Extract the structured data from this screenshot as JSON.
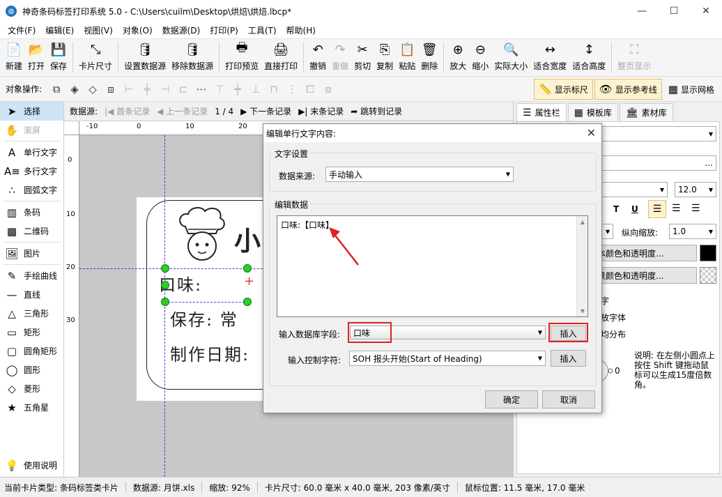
{
  "window": {
    "app_icon_glyph": "◍",
    "title": "神奇条码标签打印系统 5.0 - C:\\Users\\cuilm\\Desktop\\烘焙\\烘焙.lbcp*",
    "minimize": "—",
    "maximize": "☐",
    "close": "✕"
  },
  "menu": [
    "文件(F)",
    "编辑(E)",
    "视图(V)",
    "对象(O)",
    "数据源(D)",
    "打印(P)",
    "工具(T)",
    "帮助(H)"
  ],
  "toolbar": [
    {
      "label": "新建",
      "icon": "📄",
      "name": "new-icon"
    },
    {
      "label": "打开",
      "icon": "📂",
      "name": "open-icon"
    },
    {
      "label": "保存",
      "icon": "💾",
      "name": "save-icon"
    },
    {
      "label": "卡片尺寸",
      "icon": "⤡",
      "name": "card-size-icon"
    },
    {
      "label": "设置数据源",
      "icon": "🛢",
      "name": "set-datasource-icon"
    },
    {
      "label": "移除数据源",
      "icon": "🛢",
      "name": "remove-datasource-icon"
    },
    {
      "label": "打印预览",
      "icon": "🖶",
      "name": "print-preview-icon"
    },
    {
      "label": "直接打印",
      "icon": "🖨",
      "name": "print-icon"
    },
    {
      "label": "撤销",
      "icon": "↶",
      "name": "undo-icon"
    },
    {
      "label": "重做",
      "icon": "↷",
      "name": "redo-icon"
    },
    {
      "label": "剪切",
      "icon": "✂",
      "name": "cut-icon"
    },
    {
      "label": "复制",
      "icon": "⎘",
      "name": "copy-icon"
    },
    {
      "label": "粘贴",
      "icon": "📋",
      "name": "paste-icon"
    },
    {
      "label": "删除",
      "icon": "🗑",
      "name": "delete-icon"
    },
    {
      "label": "放大",
      "icon": "⊕",
      "name": "zoom-in-icon"
    },
    {
      "label": "缩小",
      "icon": "⊖",
      "name": "zoom-out-icon"
    },
    {
      "label": "实际大小",
      "icon": "🔍",
      "name": "actual-size-icon"
    },
    {
      "label": "适合宽度",
      "icon": "↔",
      "name": "fit-width-icon"
    },
    {
      "label": "适合高度",
      "icon": "↕",
      "name": "fit-height-icon"
    },
    {
      "label": "整页显示",
      "icon": "⛶",
      "name": "fit-page-icon"
    }
  ],
  "objbar": {
    "label": "对象操作:",
    "show_ruler": "显示标尺",
    "show_guides": "显示参考线",
    "show_grid": "显示网格",
    "ruler_icon": "📏",
    "guides_icon": "👁",
    "grid_icon": "▦"
  },
  "left_tools": [
    {
      "label": "选择",
      "icon": "➤",
      "name": "select-tool",
      "icon_name": "cursor-icon"
    },
    {
      "label": "滚屏",
      "icon": "✋",
      "name": "scroll-tool",
      "icon_name": "hand-icon"
    },
    {
      "label": "单行文字",
      "icon": "A",
      "name": "single-line-text-tool",
      "icon_name": "text-icon"
    },
    {
      "label": "多行文字",
      "icon": "A≡",
      "name": "multi-line-text-tool",
      "icon_name": "multiline-text-icon"
    },
    {
      "label": "圆弧文字",
      "icon": "∴",
      "name": "arc-text-tool",
      "icon_name": "arc-text-icon"
    },
    {
      "label": "条码",
      "icon": "▥",
      "name": "barcode-tool",
      "icon_name": "barcode-icon"
    },
    {
      "label": "二维码",
      "icon": "▩",
      "name": "qrcode-tool",
      "icon_name": "qrcode-icon"
    },
    {
      "label": "图片",
      "icon": "🖼",
      "name": "image-tool",
      "icon_name": "image-icon"
    },
    {
      "label": "手绘曲线",
      "icon": "✎",
      "name": "freehand-tool",
      "icon_name": "pen-icon"
    },
    {
      "label": "直线",
      "icon": "—",
      "name": "line-tool",
      "icon_name": "line-icon"
    },
    {
      "label": "三角形",
      "icon": "△",
      "name": "triangle-tool",
      "icon_name": "triangle-icon"
    },
    {
      "label": "矩形",
      "icon": "▭",
      "name": "rectangle-tool",
      "icon_name": "rectangle-icon"
    },
    {
      "label": "圆角矩形",
      "icon": "▢",
      "name": "rounded-rect-tool",
      "icon_name": "rounded-rect-icon"
    },
    {
      "label": "圆形",
      "icon": "◯",
      "name": "circle-tool",
      "icon_name": "circle-icon"
    },
    {
      "label": "菱形",
      "icon": "◇",
      "name": "diamond-tool",
      "icon_name": "diamond-icon"
    },
    {
      "label": "五角星",
      "icon": "★",
      "name": "star-tool",
      "icon_name": "star-icon"
    }
  ],
  "help": {
    "label": "使用说明",
    "icon": "💡"
  },
  "navbar": {
    "datasource_label": "数据源:",
    "first": "|◀ 首条记录",
    "prev": "◀ 上一条记录",
    "counter": "1 / 4",
    "next": "▶ 下一条记录",
    "last": "▶| 末条记录",
    "jump": "➦ 跳转到记录"
  },
  "ruler": {
    "h_ticks": [
      "-10",
      "0",
      "10",
      "20"
    ],
    "v_ticks": [
      "0",
      "10",
      "20",
      "30"
    ]
  },
  "label": {
    "title_char": "小",
    "line1_prefix": "口味:",
    "line2": "保存: 常",
    "line3": "制作日期:",
    "cursor_mark": "+"
  },
  "right_panel": {
    "tabs": [
      {
        "label": "属性栏",
        "icon": "☰",
        "name": "tab-properties"
      },
      {
        "label": "模板库",
        "icon": "▦",
        "name": "tab-templates"
      },
      {
        "label": "素材库",
        "icon": "🏛",
        "name": "tab-materials"
      }
    ],
    "font_size": "12.0",
    "style_buttons": [
      "T",
      "U"
    ],
    "v_scale_label": "纵向缩放:",
    "v_scale_value": "1.0",
    "text_color_btn": "本颜色和透明度...",
    "bg_color_btn": "景颜色和透明度...",
    "line_zi": "字",
    "line_font": "放字体",
    "line_dist": "均分布",
    "rotate_value": "0",
    "hint": "说明: 在左侧小圆点上按住 Shift 键拖动鼠标可以生成15度倍数角。",
    "ellipsis": "..."
  },
  "status": {
    "card_type": "当前卡片类型: 条码标签类卡片",
    "datasource": "数据源: 月饼.xls",
    "zoom": "缩放: 92%",
    "card_size": "卡片尺寸: 60.0 毫米 x 40.0 毫米, 203 像素/英寸",
    "mouse": "鼠标位置: 11.5 毫米, 17.0 毫米"
  },
  "dialog": {
    "title": "编辑单行文字内容:",
    "close": "✕",
    "group_text": "文字设置",
    "source_label": "数据来源:",
    "source_value": "手动输入",
    "group_edit": "编辑数据",
    "content": "口味:【口味】",
    "db_field_label": "输入数据库字段:",
    "db_field_value": "口味",
    "insert1": "插入",
    "ctrl_label": "输入控制字符:",
    "ctrl_value": "SOH  报头开始(Start of Heading)",
    "insert2": "插入",
    "ok": "确定",
    "cancel": "取消"
  },
  "colors": {
    "highlight_red": "#e02020",
    "handle_green": "#2ecc2e",
    "guide_blue": "#3b3bd6"
  }
}
